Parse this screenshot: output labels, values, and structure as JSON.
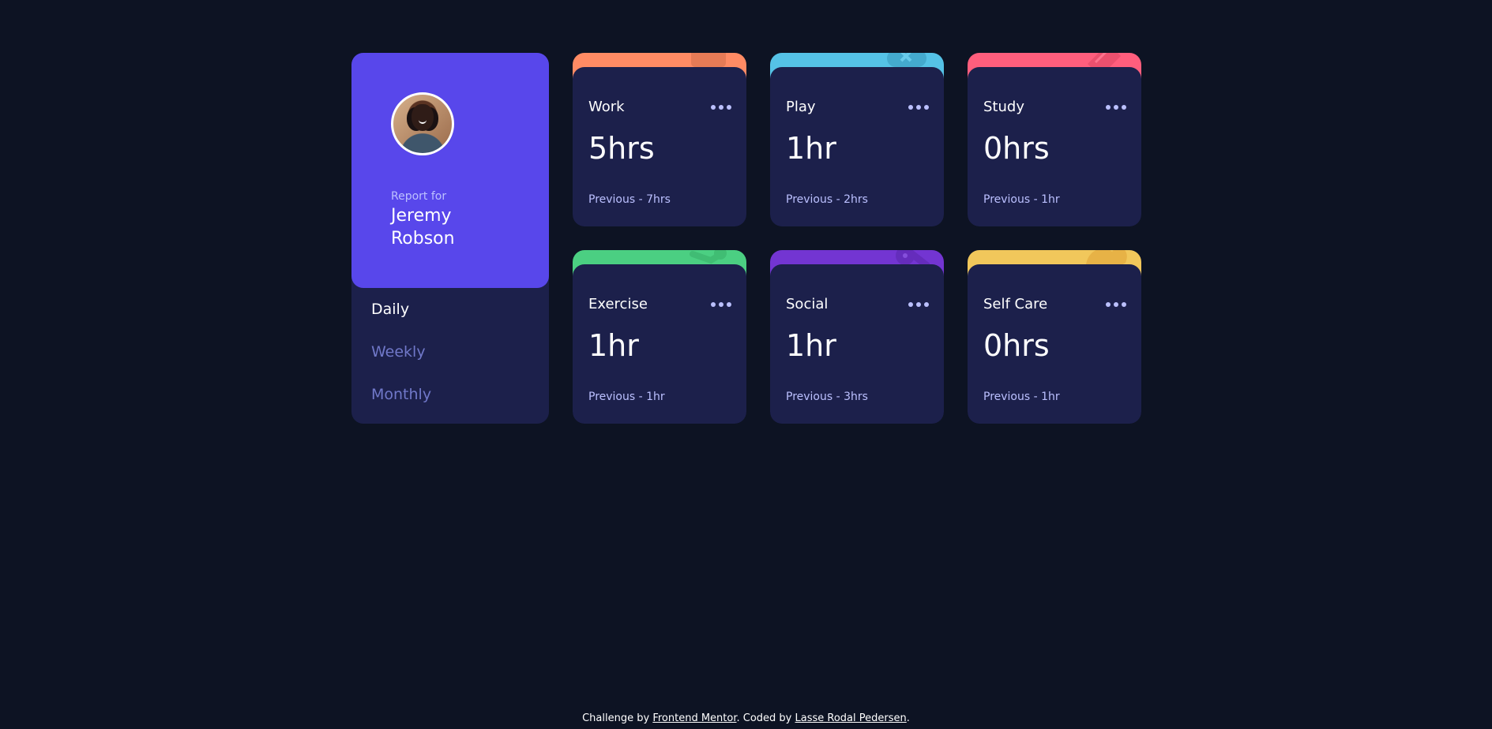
{
  "profile": {
    "report_label": "Report for",
    "name": "Jeremy Robson",
    "avatar_icon": "portrait-photo"
  },
  "periods": [
    {
      "label": "Daily",
      "selected": true
    },
    {
      "label": "Weekly",
      "selected": false
    },
    {
      "label": "Monthly",
      "selected": false
    }
  ],
  "cards": [
    {
      "title": "Work",
      "value": "5hrs",
      "previous": "Previous - 7hrs",
      "accent": "#ff8b64",
      "icon": "briefcase-icon",
      "menu_icon": "ellipsis-icon"
    },
    {
      "title": "Play",
      "value": "1hr",
      "previous": "Previous - 2hrs",
      "accent": "#55c2e6",
      "icon": "game-controller-icon",
      "menu_icon": "ellipsis-icon"
    },
    {
      "title": "Study",
      "value": "0hrs",
      "previous": "Previous - 1hr",
      "accent": "#ff5e7d",
      "icon": "book-icon",
      "menu_icon": "ellipsis-icon"
    },
    {
      "title": "Exercise",
      "value": "1hr",
      "previous": "Previous - 1hr",
      "accent": "#4bcf82",
      "icon": "running-icon",
      "menu_icon": "ellipsis-icon"
    },
    {
      "title": "Social",
      "value": "1hr",
      "previous": "Previous - 3hrs",
      "accent": "#7335d2",
      "icon": "chat-icon",
      "menu_icon": "ellipsis-icon"
    },
    {
      "title": "Self Care",
      "value": "0hrs",
      "previous": "Previous - 1hr",
      "accent": "#f1c75b",
      "icon": "heart-icon",
      "menu_icon": "ellipsis-icon"
    }
  ],
  "footer": {
    "prefix": "Challenge by ",
    "challenge_link": "Frontend Mentor",
    "middle": ". Coded by ",
    "author_link": "Lasse Rodal Pedersen",
    "suffix": "."
  },
  "colors": {
    "page_background": "#0d1323",
    "panel_background": "#1c204b",
    "profile_background": "#5847eb",
    "muted_text": "#bbc0ff",
    "inactive_period_text": "#7078c9"
  }
}
